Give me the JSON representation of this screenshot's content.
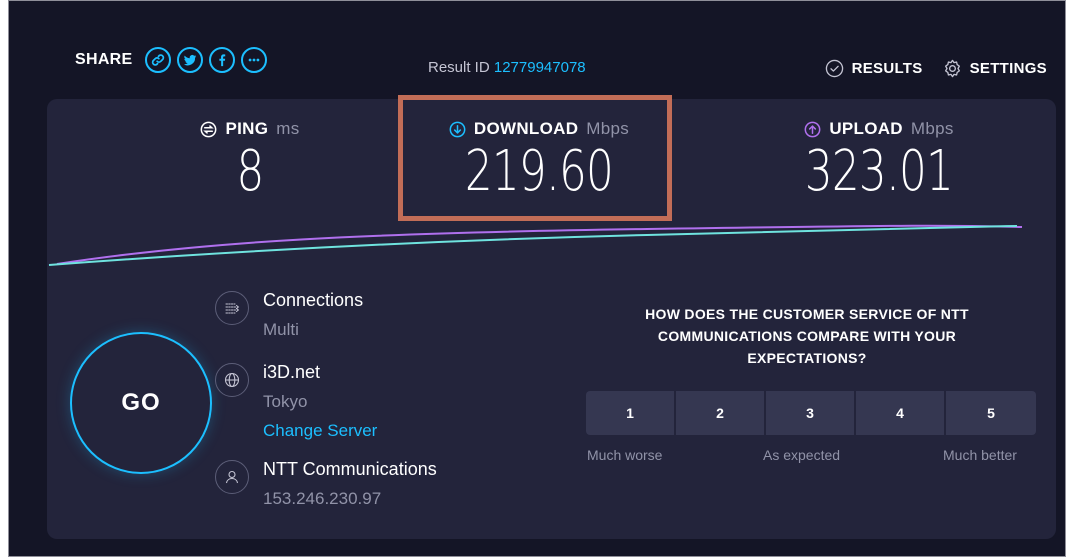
{
  "share": {
    "label": "SHARE",
    "buttons": [
      "link-icon",
      "twitter-icon",
      "facebook-icon",
      "more-icon"
    ]
  },
  "result": {
    "label": "Result ID",
    "id": "12779947078"
  },
  "nav": {
    "results_label": "RESULTS",
    "settings_label": "SETTINGS"
  },
  "metrics": {
    "ping": {
      "label": "PING",
      "unit": "ms",
      "value": "8"
    },
    "download": {
      "label": "DOWNLOAD",
      "unit": "Mbps",
      "value": "219.60"
    },
    "upload": {
      "label": "UPLOAD",
      "unit": "Mbps",
      "value": "323.01"
    }
  },
  "go_label": "GO",
  "server": {
    "connections_title": "Connections",
    "connections_value": "Multi",
    "host": "i3D.net",
    "location": "Tokyo",
    "change_server": "Change Server",
    "provider": "NTT Communications",
    "ip": "153.246.230.97"
  },
  "survey": {
    "question": "HOW DOES THE CUSTOMER SERVICE OF NTT COMMUNICATIONS COMPARE WITH YOUR EXPECTATIONS?",
    "options": [
      "1",
      "2",
      "3",
      "4",
      "5"
    ],
    "scale_low": "Much worse",
    "scale_mid": "As expected",
    "scale_high": "Much better"
  },
  "colors": {
    "background": "#141526",
    "panel": "#23243b",
    "accent": "#1cbfff",
    "upload_accent": "#b070ee",
    "highlight": "#c26d57"
  }
}
